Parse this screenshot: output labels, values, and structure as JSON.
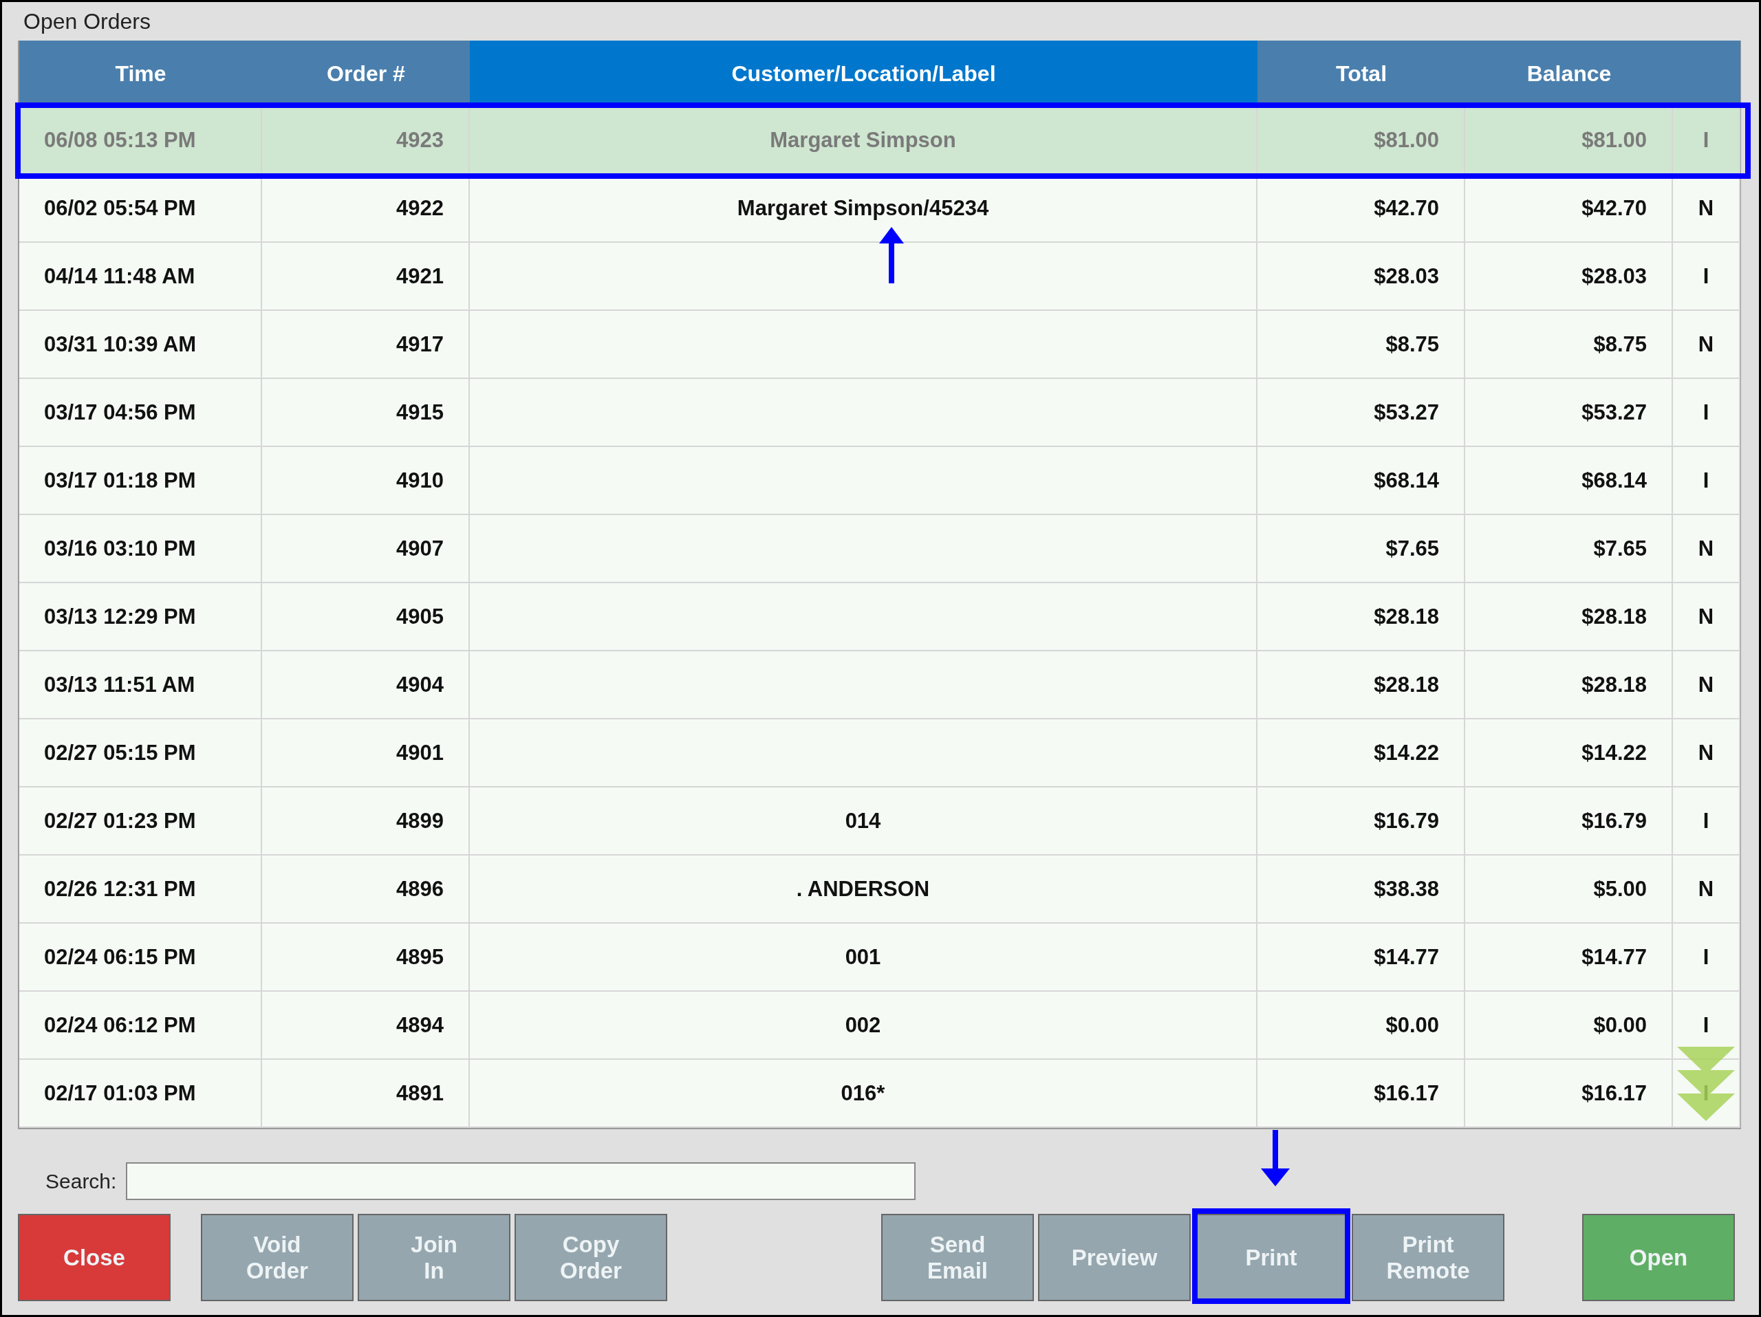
{
  "window": {
    "title": "Open Orders"
  },
  "table": {
    "columns": [
      {
        "label": "Time",
        "selected": false
      },
      {
        "label": "Order #",
        "selected": false
      },
      {
        "label": "Customer/Location/Label",
        "selected": true
      },
      {
        "label": "Total",
        "selected": false
      },
      {
        "label": "Balance",
        "selected": false
      }
    ],
    "rows": [
      {
        "time": "06/08 05:13 PM",
        "order": "4923",
        "customer": "Margaret Simpson",
        "total": "$81.00",
        "balance": "$81.00",
        "status": "I",
        "selected": true,
        "callout": true
      },
      {
        "time": "06/02 05:54 PM",
        "order": "4922",
        "customer": "Margaret Simpson/45234",
        "total": "$42.70",
        "balance": "$42.70",
        "status": "N",
        "selected": false,
        "callout": false
      },
      {
        "time": "04/14 11:48 AM",
        "order": "4921",
        "customer": "",
        "total": "$28.03",
        "balance": "$28.03",
        "status": "I",
        "selected": false,
        "callout": false
      },
      {
        "time": "03/31 10:39 AM",
        "order": "4917",
        "customer": "",
        "total": "$8.75",
        "balance": "$8.75",
        "status": "N",
        "selected": false,
        "callout": false
      },
      {
        "time": "03/17 04:56 PM",
        "order": "4915",
        "customer": "",
        "total": "$53.27",
        "balance": "$53.27",
        "status": "I",
        "selected": false,
        "callout": false
      },
      {
        "time": "03/17 01:18 PM",
        "order": "4910",
        "customer": "",
        "total": "$68.14",
        "balance": "$68.14",
        "status": "I",
        "selected": false,
        "callout": false
      },
      {
        "time": "03/16 03:10 PM",
        "order": "4907",
        "customer": "",
        "total": "$7.65",
        "balance": "$7.65",
        "status": "N",
        "selected": false,
        "callout": false
      },
      {
        "time": "03/13 12:29 PM",
        "order": "4905",
        "customer": "",
        "total": "$28.18",
        "balance": "$28.18",
        "status": "N",
        "selected": false,
        "callout": false
      },
      {
        "time": "03/13 11:51 AM",
        "order": "4904",
        "customer": "",
        "total": "$28.18",
        "balance": "$28.18",
        "status": "N",
        "selected": false,
        "callout": false
      },
      {
        "time": "02/27 05:15 PM",
        "order": "4901",
        "customer": "",
        "total": "$14.22",
        "balance": "$14.22",
        "status": "N",
        "selected": false,
        "callout": false
      },
      {
        "time": "02/27 01:23 PM",
        "order": "4899",
        "customer": "014",
        "total": "$16.79",
        "balance": "$16.79",
        "status": "I",
        "selected": false,
        "callout": false
      },
      {
        "time": "02/26 12:31 PM",
        "order": "4896",
        "customer": ". ANDERSON",
        "total": "$38.38",
        "balance": "$5.00",
        "status": "N",
        "selected": false,
        "callout": false
      },
      {
        "time": "02/24 06:15 PM",
        "order": "4895",
        "customer": "001",
        "total": "$14.77",
        "balance": "$14.77",
        "status": "I",
        "selected": false,
        "callout": false
      },
      {
        "time": "02/24 06:12 PM",
        "order": "4894",
        "customer": "002",
        "total": "$0.00",
        "balance": "$0.00",
        "status": "I",
        "selected": false,
        "callout": false
      },
      {
        "time": "02/17 01:03 PM",
        "order": "4891",
        "customer": "016*",
        "total": "$16.17",
        "balance": "$16.17",
        "status": "I",
        "selected": false,
        "callout": false
      }
    ]
  },
  "search": {
    "label": "Search:"
  },
  "button_groups": [
    [
      {
        "label": "Close",
        "kind": "close",
        "callout": false
      }
    ],
    [
      {
        "label": "Void\nOrder",
        "kind": "action",
        "callout": false
      },
      {
        "label": "Join\nIn",
        "kind": "action",
        "callout": false
      },
      {
        "label": "Copy\nOrder",
        "kind": "action",
        "callout": false
      }
    ],
    [
      {
        "label": "Send\nEmail",
        "kind": "action",
        "callout": false
      },
      {
        "label": "Preview",
        "kind": "action",
        "callout": false
      },
      {
        "label": "Print",
        "kind": "action",
        "callout": true
      },
      {
        "label": "Print\nRemote",
        "kind": "action",
        "callout": false
      }
    ],
    [
      {
        "label": "Open",
        "kind": "open",
        "callout": false
      }
    ]
  ]
}
